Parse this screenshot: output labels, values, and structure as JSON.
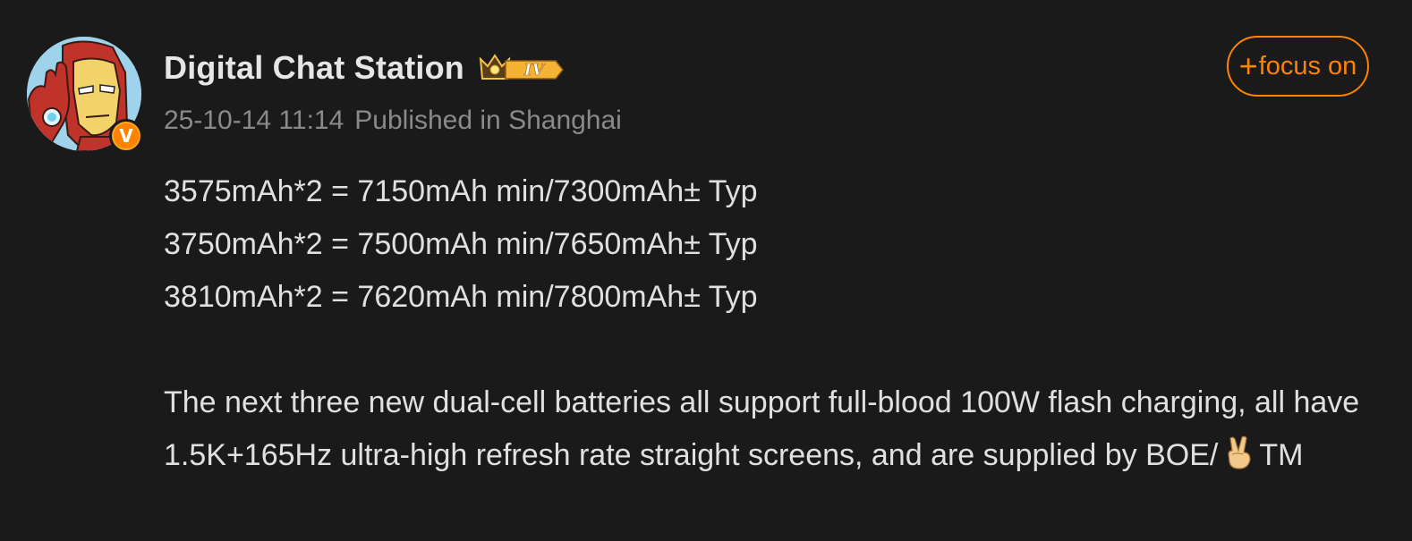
{
  "user": {
    "name": "Digital Chat Station",
    "level": "IV",
    "verified_mark": "V",
    "avatar_icon": "iron-man-avatar"
  },
  "meta": {
    "timestamp": "25-10-14 11:14",
    "location": "Published in Shanghai"
  },
  "follow": {
    "plus": "+",
    "label": "focus on"
  },
  "content": {
    "lines": [
      "3575mAh*2 = 7150mAh min/7300mAh± Typ",
      "3750mAh*2 = 7500mAh min/7650mAh± Typ",
      "3810mAh*2 = 7620mAh min/7800mAh± Typ"
    ],
    "paragraph": "The next three new dual-cell batteries all support full-blood 100W flash charging, all have 1.5K+165Hz ultra-high refresh rate straight screens, and are supplied by BOE/",
    "paragraph_tail": "TM",
    "emoji": "peace-hand-emoji"
  },
  "colors": {
    "background": "#1a1a1a",
    "accent": "#ff8200",
    "text": "#e0e0e0",
    "muted": "#8a8a8a"
  }
}
